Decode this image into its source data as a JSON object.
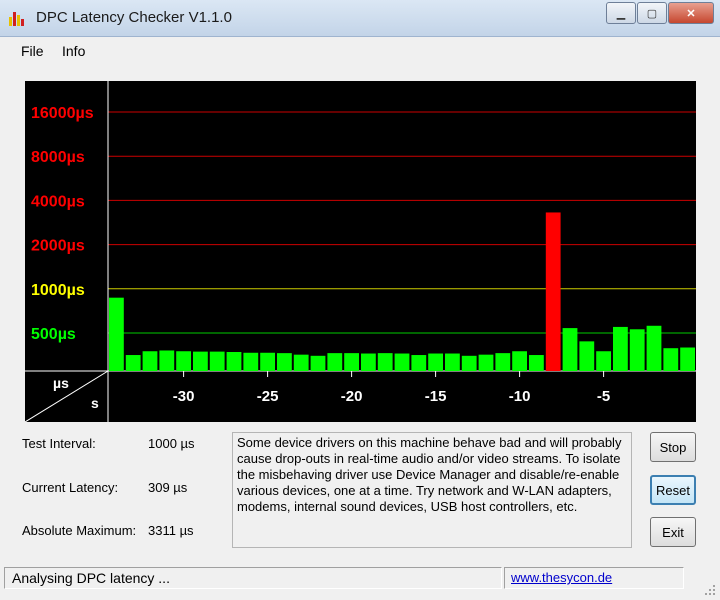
{
  "window": {
    "title": "DPC Latency Checker V1.1.0"
  },
  "menu": {
    "file": "File",
    "info": "Info"
  },
  "chart_data": {
    "type": "bar",
    "y_axis_unit": "µs",
    "x_axis_unit": "s",
    "y_ticks": [
      {
        "label": "16000µs",
        "value": 16000,
        "color": "#ff0000"
      },
      {
        "label": "8000µs",
        "value": 8000,
        "color": "#ff0000"
      },
      {
        "label": "4000µs",
        "value": 4000,
        "color": "#ff0000"
      },
      {
        "label": "2000µs",
        "value": 2000,
        "color": "#ff0000"
      },
      {
        "label": "1000µs",
        "value": 1000,
        "color": "#ffff00"
      },
      {
        "label": "500µs",
        "value": 500,
        "color": "#00ff00"
      }
    ],
    "x_ticks": [
      "-30",
      "-25",
      "-20",
      "-15",
      "-10",
      "-5"
    ],
    "x_tick_values": [
      -30,
      -25,
      -20,
      -15,
      -10,
      -5
    ],
    "x_range": [
      -34,
      0
    ],
    "bars_x": [
      -34,
      -33,
      -32,
      -31,
      -30,
      -29,
      -28,
      -27,
      -26,
      -25,
      -24,
      -23,
      -22,
      -21,
      -20,
      -19,
      -18,
      -17,
      -16,
      -15,
      -14,
      -13,
      -12,
      -11,
      -10,
      -9,
      -8,
      -7,
      -6,
      -5,
      -4,
      -3,
      -2,
      -1
    ],
    "bars_us": [
      870,
      210,
      260,
      270,
      260,
      255,
      255,
      250,
      240,
      240,
      235,
      215,
      200,
      235,
      235,
      230,
      235,
      230,
      210,
      230,
      230,
      200,
      215,
      235,
      260,
      210,
      3311,
      540,
      390,
      260,
      550,
      530,
      560,
      300,
      309
    ],
    "bar_colors": {
      "normal": "#00ff00",
      "alarm": "#ff0000"
    },
    "grid_colors": {
      "red": "#cc0000",
      "yellow": "#cccc00",
      "green": "#00cc00"
    }
  },
  "stats": {
    "test_interval_label": "Test Interval:",
    "test_interval_value": "1000 µs",
    "current_latency_label": "Current Latency:",
    "current_latency_value": "309 µs",
    "absolute_max_label": "Absolute Maximum:",
    "absolute_max_value": "3311 µs"
  },
  "message": "Some device drivers on this machine behave bad and will probably cause drop-outs in real-time audio and/or video streams. To isolate the misbehaving driver use Device Manager and disable/re-enable various devices, one at a time. Try network and W-LAN adapters, modems, internal sound devices, USB host controllers, etc.",
  "buttons": {
    "stop": "Stop",
    "reset": "Reset",
    "exit": "Exit"
  },
  "status": {
    "text": "Analysing DPC latency ...",
    "link": "www.thesycon.de"
  }
}
